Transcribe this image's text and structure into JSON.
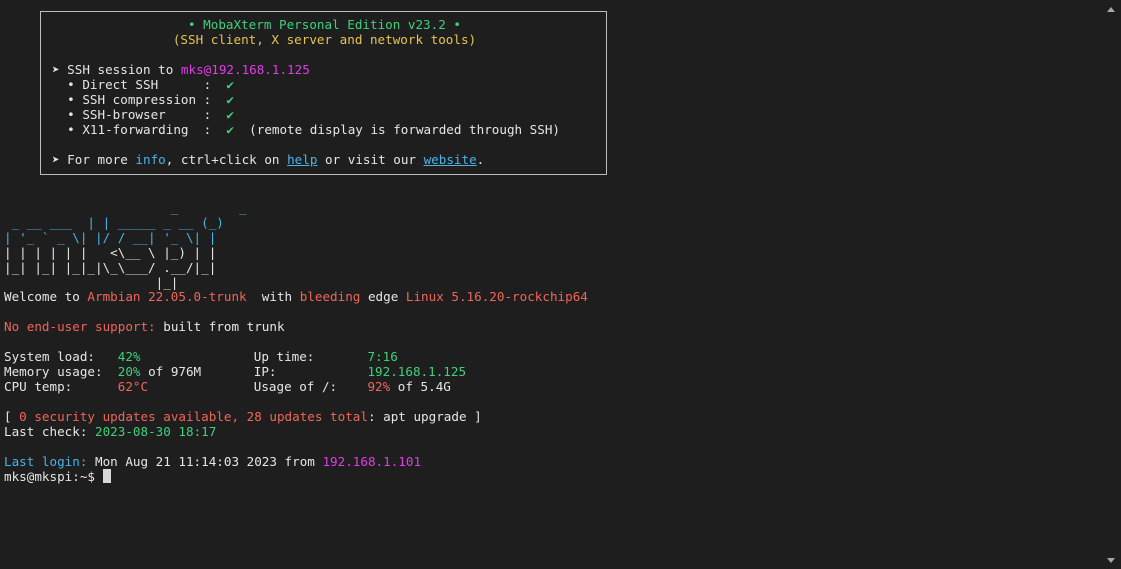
{
  "banner": {
    "title": "• MobaXterm Personal Edition v23.2 •",
    "subtitle": "(SSH client, X server and network tools)",
    "session_prefix": "➤ SSH session to ",
    "session_target": "mks@192.168.1.125",
    "features": [
      {
        "label": "  • Direct SSH      :  ",
        "check": "✔",
        "note": ""
      },
      {
        "label": "  • SSH compression :  ",
        "check": "✔",
        "note": ""
      },
      {
        "label": "  • SSH-browser     :  ",
        "check": "✔",
        "note": ""
      },
      {
        "label": "  • X11-forwarding  :  ",
        "check": "✔",
        "note": "  (remote display is forwarded through SSH)"
      }
    ],
    "more_prefix": "➤ For more ",
    "info_link": "info",
    "more_mid": ", ctrl+click on ",
    "help_link": "help",
    "more_mid2": " or visit our ",
    "website_link": "website",
    "more_end": "."
  },
  "logo": {
    "lines": [
      "                      _        _ ",
      " _ __ ___  | | _____ _ __ (_)",
      "| '_ ` _ \\| |/ / __| '_ \\| |",
      "| | | | | |   <\\__ \\ |_) | |",
      "|_| |_| |_|_|\\_\\___/ .__/|_|",
      "                    |_|      "
    ]
  },
  "welcome": {
    "prefix": "Welcome to ",
    "distro": "Armbian 22.05.0-trunk",
    "mid": "  with ",
    "bleeding": "bleeding",
    "edge": " edge ",
    "kernel": "Linux 5.16.20-rockchip64"
  },
  "support": {
    "label": "No end-user support:",
    "text": " built from trunk"
  },
  "stats": {
    "system_load_label": "System load:   ",
    "system_load": "42%",
    "uptime_label": "Up time:       ",
    "uptime": "7:16",
    "memory_label": "Memory usage:  ",
    "memory_pct": "20%",
    "memory_rest": " of 976M",
    "ip_label": "IP:            ",
    "ip": "192.168.1.125",
    "cpu_label": "CPU temp:      ",
    "cpu_temp": "62°C",
    "usage_label": "Usage of /:    ",
    "usage_pct": "92%",
    "usage_rest": " of 5.4G"
  },
  "updates": {
    "open": "[",
    "text": " 0 security updates available, 28 updates total",
    "cmd": ": apt upgrade ]",
    "last_check_label": "Last check: ",
    "last_check": "2023-08-30 18:17"
  },
  "login": {
    "label": "Last login:",
    "when": " Mon Aug 21 11:14:03 2023 from ",
    "from": "192.168.1.101"
  },
  "prompt": {
    "text": "mks@mkspi:~$ "
  },
  "colors": {
    "background": "#1e1e1e",
    "green": "#3fd17a",
    "yellow": "#e8c34f",
    "magenta": "#e03ce8",
    "cyan": "#49b4e8",
    "red": "#f0655a"
  }
}
